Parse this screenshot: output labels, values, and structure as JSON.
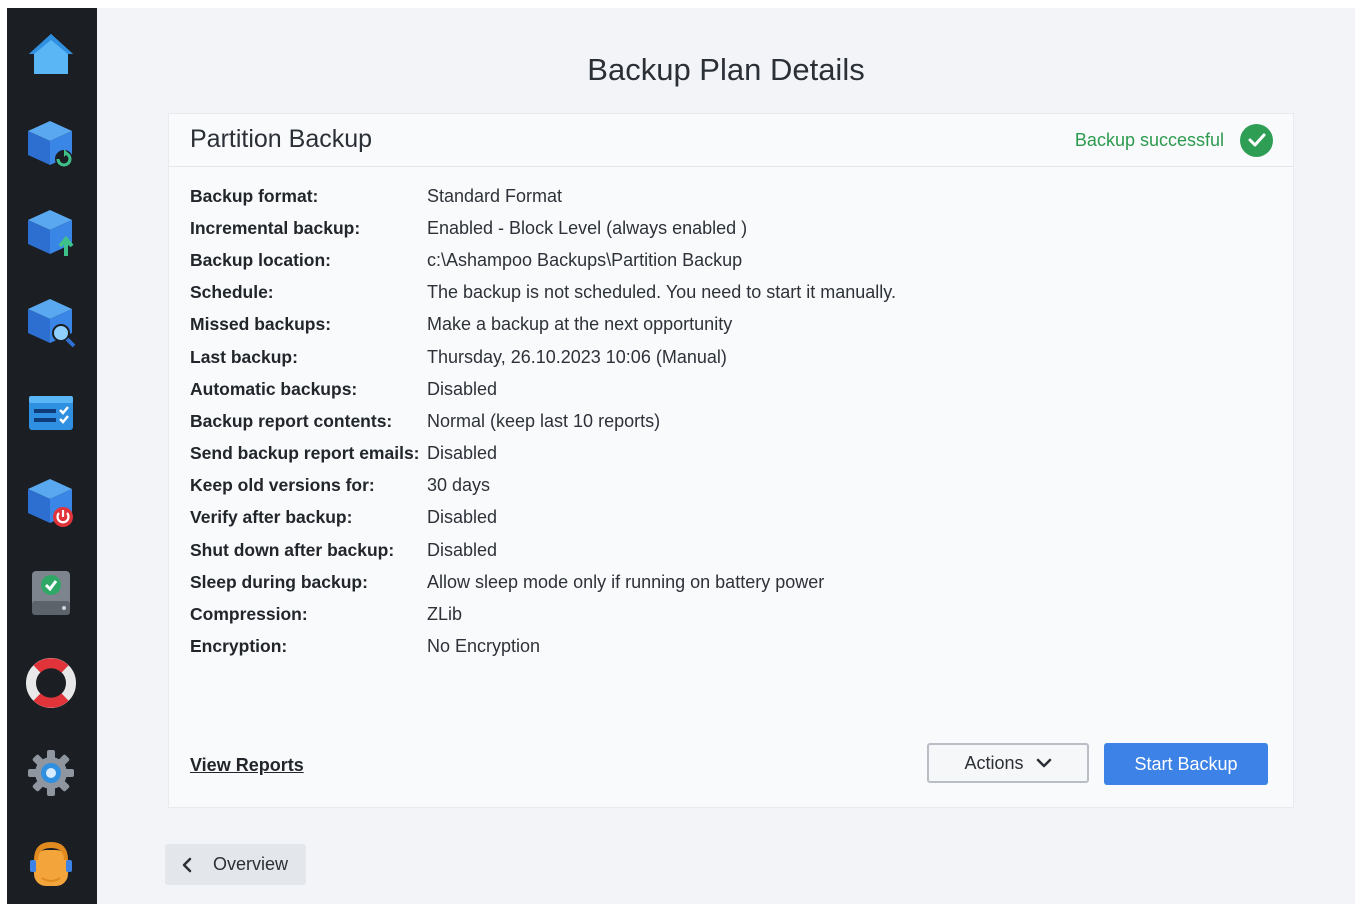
{
  "sidebar": {
    "items": [
      {
        "icon": "home-icon"
      },
      {
        "icon": "backup-restore-cube-icon"
      },
      {
        "icon": "backup-upload-cube-icon"
      },
      {
        "icon": "backup-search-cube-icon"
      },
      {
        "icon": "task-list-icon"
      },
      {
        "icon": "backup-power-cube-icon"
      },
      {
        "icon": "drive-check-icon"
      },
      {
        "icon": "lifebuoy-icon"
      },
      {
        "icon": "gear-icon"
      },
      {
        "icon": "support-avatar-icon"
      }
    ]
  },
  "page": {
    "title": "Backup Plan Details"
  },
  "card": {
    "title": "Partition Backup",
    "status_text": "Backup successful",
    "status_color": "#2f9e55",
    "details": [
      {
        "label": "Backup format:",
        "value": "Standard Format"
      },
      {
        "label": "Incremental backup:",
        "value": "Enabled - Block Level (always enabled )"
      },
      {
        "label": "Backup location:",
        "value": "c:\\Ashampoo Backups\\Partition Backup"
      },
      {
        "label": "Schedule:",
        "value": "The backup is not scheduled. You need to start it manually."
      },
      {
        "label": "Missed backups:",
        "value": "Make a backup at the next opportunity"
      },
      {
        "label": "Last backup:",
        "value": "Thursday, 26.10.2023 10:06 (Manual)"
      },
      {
        "label": "Automatic backups:",
        "value": "Disabled"
      },
      {
        "label": "Backup report contents:",
        "value": "Normal (keep last 10 reports)"
      },
      {
        "label": "Send backup report emails:",
        "value": "Disabled"
      },
      {
        "label": "Keep old versions for:",
        "value": "30 days"
      },
      {
        "label": "Verify after backup:",
        "value": "Disabled"
      },
      {
        "label": "Shut down after backup:",
        "value": "Disabled"
      },
      {
        "label": "Sleep during backup:",
        "value": "Allow sleep mode only if running on battery power"
      },
      {
        "label": "Compression:",
        "value": "ZLib"
      },
      {
        "label": "Encryption:",
        "value": "No Encryption"
      }
    ],
    "view_reports_label": "View Reports",
    "actions_label": "Actions",
    "start_backup_label": "Start Backup",
    "accent_color": "#3d82e6"
  },
  "footer": {
    "overview_label": "Overview"
  }
}
